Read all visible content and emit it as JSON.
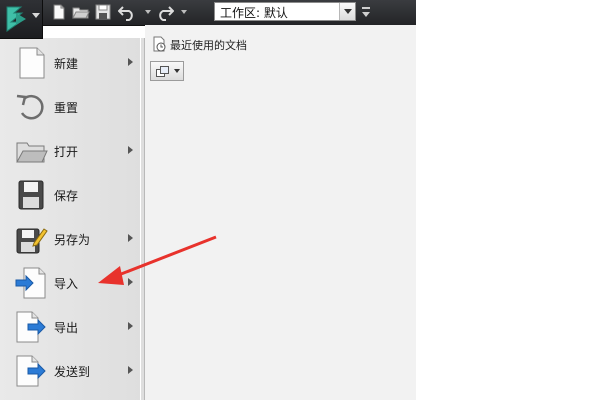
{
  "toolbar": {
    "workspace_label": "工作区: 默认"
  },
  "menu": {
    "items": [
      {
        "label": "新建",
        "icon": "new-document-icon",
        "has_submenu": true
      },
      {
        "label": "重置",
        "icon": "reset-icon",
        "has_submenu": false
      },
      {
        "label": "打开",
        "icon": "open-folder-icon",
        "has_submenu": true
      },
      {
        "label": "保存",
        "icon": "save-icon",
        "has_submenu": false
      },
      {
        "label": "另存为",
        "icon": "save-as-icon",
        "has_submenu": true
      },
      {
        "label": "导入",
        "icon": "import-icon",
        "has_submenu": true
      },
      {
        "label": "导出",
        "icon": "export-icon",
        "has_submenu": true
      },
      {
        "label": "发送到",
        "icon": "send-to-icon",
        "has_submenu": true
      }
    ]
  },
  "recent": {
    "title": "最近使用的文档"
  },
  "colors": {
    "annotation": "#e8322c",
    "import_arrow": "#2b7bd6"
  }
}
